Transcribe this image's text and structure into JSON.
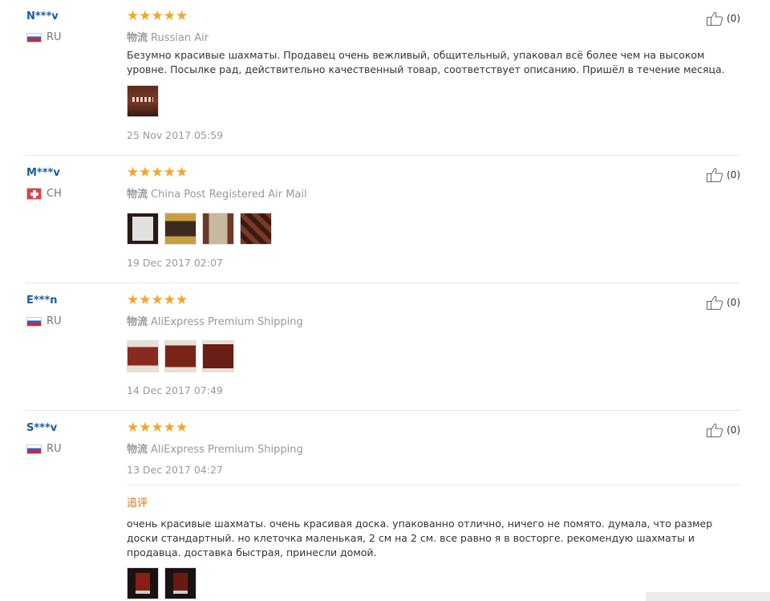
{
  "reviews": [
    {
      "user": "N***v",
      "country": "RU",
      "flag": "ru",
      "shipping_label": "物流",
      "shipping": "Russian Air",
      "text": "Безумно красивые шахматы. Продавец очень вежливый, общительный, упаковал всё более чем на высоком уровне. Посылке рад, действительно качественный товар, соответствует описанию. Пришёл в течение месяца.",
      "date": "25 Nov 2017 05:59",
      "likes": "(0)"
    },
    {
      "user": "M***v",
      "country": "CH",
      "flag": "ch",
      "shipping_label": "物流",
      "shipping": "China Post Registered Air Mail",
      "date": "19 Dec 2017 02:07",
      "likes": "(0)"
    },
    {
      "user": "E***n",
      "country": "RU",
      "flag": "ru",
      "shipping_label": "物流",
      "shipping": "AliExpress Premium Shipping",
      "date": "14 Dec 2017 07:49",
      "likes": "(0)"
    },
    {
      "user": "S***v",
      "country": "RU",
      "flag": "ru",
      "shipping_label": "物流",
      "shipping": "AliExpress Premium Shipping",
      "date": "13 Dec 2017 04:27",
      "likes": "(0)",
      "additional_title": "追评",
      "additional_text": "очень красивые шахматы. очень красивая доска. упакованно отлично, ничего не помято. думала, что размер доски стандартный. но клеточка маленькая, 2 см на 2 см. все равно я в восторге. рекомендую шахматы и продавца. доставка быстрая, принесли домой."
    }
  ],
  "stars": "★★★★★",
  "colors": {
    "star": "#f5a623",
    "username": "#1a5c9e",
    "additional": "#e06b00"
  }
}
